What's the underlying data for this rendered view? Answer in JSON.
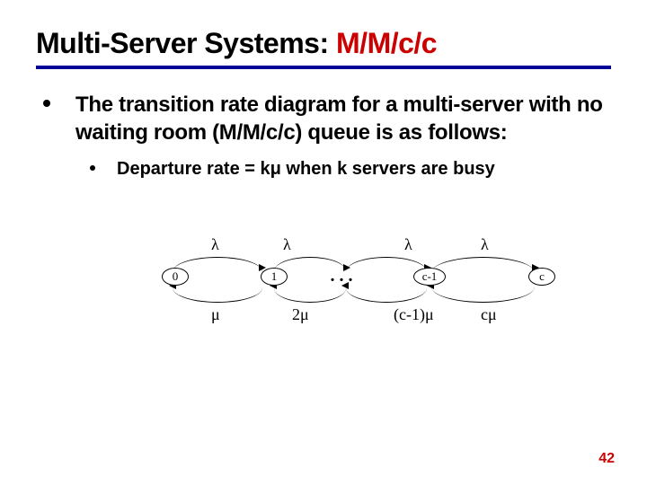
{
  "title": {
    "part1": "Multi-Server Systems: ",
    "part2": "M/M/c/c"
  },
  "bullet": "The transition rate diagram for a multi-server with no waiting room (M/M/c/c) queue is as follows:",
  "sub_bullet": "Departure rate = kμ when k servers are busy",
  "diagram": {
    "states": {
      "s0": "0",
      "s1": "1",
      "dots": ". . .",
      "sc1": "c-1",
      "sc": "c"
    },
    "lambdas": {
      "l1": "λ",
      "l2": "λ",
      "l3": "λ",
      "l4": "λ"
    },
    "mus": {
      "m1": "μ",
      "m2": "2μ",
      "m3": "(c-1)μ",
      "m4": "cμ"
    }
  },
  "page_number": "42"
}
